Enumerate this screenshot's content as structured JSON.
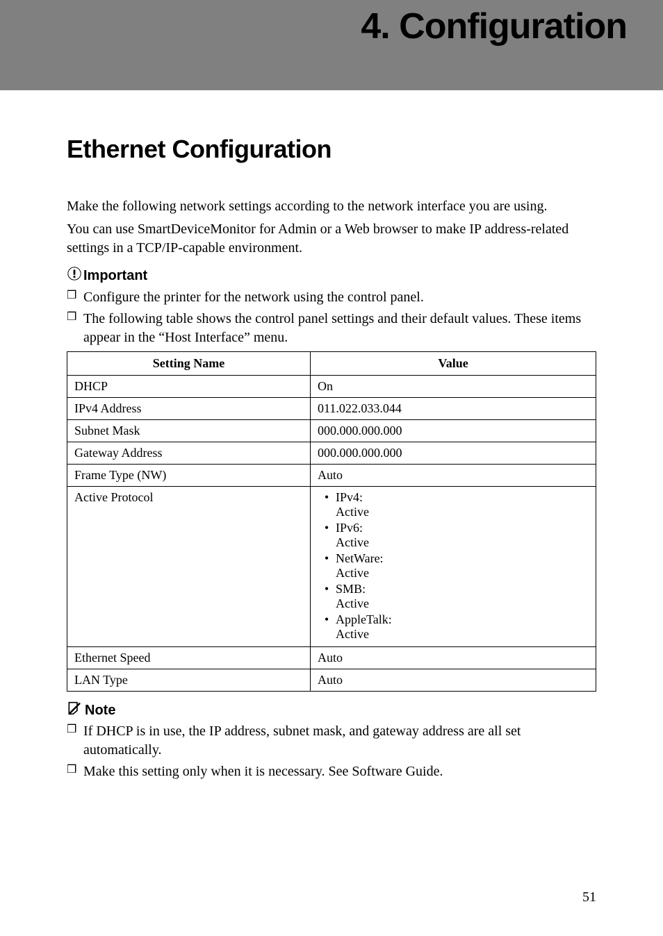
{
  "chapter": {
    "title": "4. Configuration"
  },
  "section": {
    "title": "Ethernet Configuration"
  },
  "intro": {
    "p1": "Make the following network settings according to the network interface you are using.",
    "p2": "You can use SmartDeviceMonitor for Admin or a Web browser to make IP address-related settings in a TCP/IP-capable environment."
  },
  "important": {
    "heading": "Important",
    "items": [
      "Configure the printer for the network using the control panel.",
      "The following table shows the control panel settings and their default values. These items appear in the “Host Interface” menu."
    ]
  },
  "table": {
    "header": [
      "Setting Name",
      "Value"
    ],
    "rows": [
      {
        "name": "DHCP",
        "value": "On"
      },
      {
        "name": "IPv4 Address",
        "value": "011.022.033.044"
      },
      {
        "name": "Subnet Mask",
        "value": "000.000.000.000"
      },
      {
        "name": "Gateway Address",
        "value": "000.000.000.000"
      },
      {
        "name": "Frame Type (NW)",
        "value": "Auto"
      },
      {
        "name": "Active Protocol",
        "protocols": [
          {
            "label": "IPv4:",
            "status": "Active"
          },
          {
            "label": "IPv6:",
            "status": "Active"
          },
          {
            "label": "NetWare:",
            "status": "Active"
          },
          {
            "label": "SMB:",
            "status": "Active"
          },
          {
            "label": "AppleTalk:",
            "status": "Active"
          }
        ]
      },
      {
        "name": "Ethernet Speed",
        "value": "Auto"
      },
      {
        "name": "LAN Type",
        "value": "Auto"
      }
    ]
  },
  "note": {
    "heading": "Note",
    "items": [
      "If DHCP is in use, the IP address, subnet mask, and gateway address are all set automatically.",
      "Make this setting only when it is necessary. See Software Guide."
    ]
  },
  "page_number": "51"
}
